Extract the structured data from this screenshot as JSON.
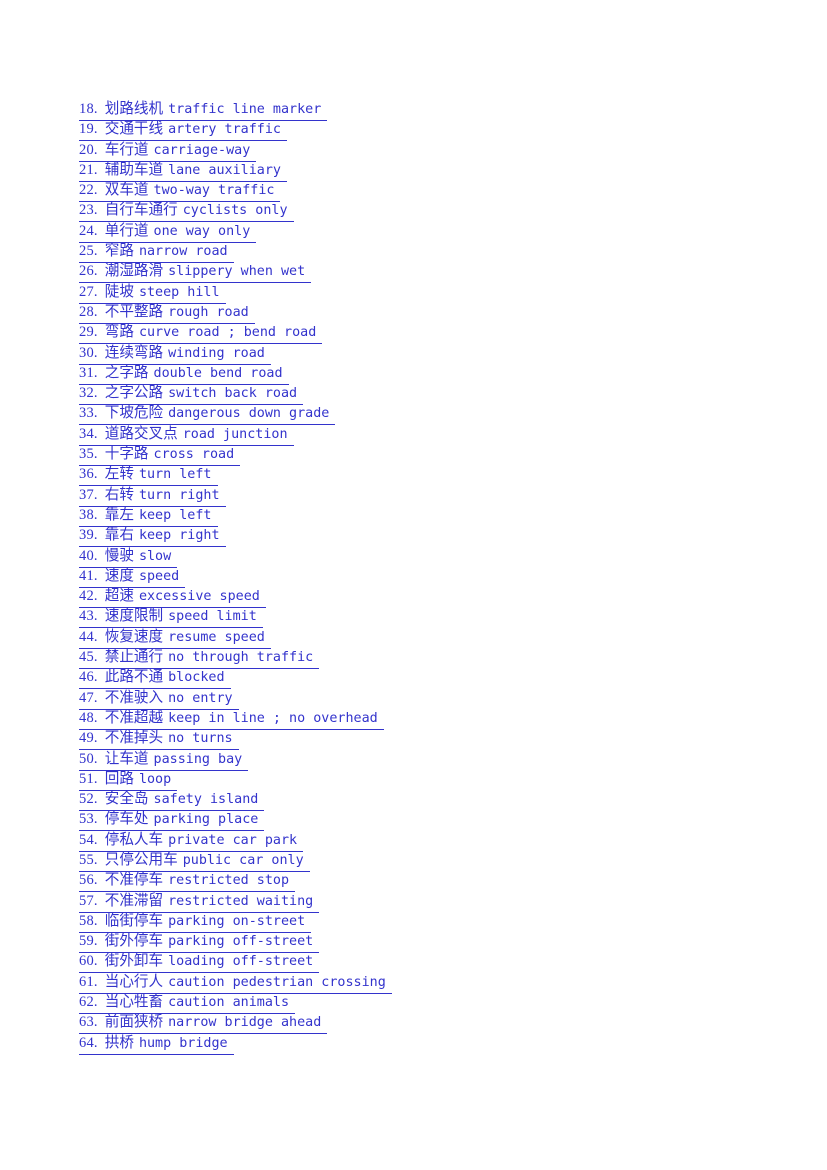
{
  "document": {
    "type": "glossary-page",
    "topic": "Road and traffic terminology (Chinese-English)",
    "link_color": "#3333CC",
    "background_color": "#FFFFFF",
    "entries": [
      {
        "number": "18.",
        "chinese": "划路线机",
        "english": "traffic line marker"
      },
      {
        "number": "19.",
        "chinese": "交通干线",
        "english": "artery traffic"
      },
      {
        "number": "20.",
        "chinese": "车行道",
        "english": "carriage-way"
      },
      {
        "number": "21.",
        "chinese": "辅助车道",
        "english": "lane auxiliary"
      },
      {
        "number": "22.",
        "chinese": "双车道",
        "english": "two-way traffic"
      },
      {
        "number": "23.",
        "chinese": "自行车通行",
        "english": "cyclists only"
      },
      {
        "number": "24.",
        "chinese": "单行道",
        "english": "one way only"
      },
      {
        "number": "25.",
        "chinese": "窄路",
        "english": "narrow road"
      },
      {
        "number": "26.",
        "chinese": "潮湿路滑",
        "english": "slippery when wet"
      },
      {
        "number": "27.",
        "chinese": "陡坡",
        "english": "steep hill"
      },
      {
        "number": "28.",
        "chinese": "不平整路",
        "english": "rough road"
      },
      {
        "number": "29.",
        "chinese": "弯路",
        "english": "curve road ; bend road"
      },
      {
        "number": "30.",
        "chinese": "连续弯路",
        "english": "winding road"
      },
      {
        "number": "31.",
        "chinese": "之字路",
        "english": "double bend road"
      },
      {
        "number": "32.",
        "chinese": "之字公路",
        "english": "switch back road"
      },
      {
        "number": "33.",
        "chinese": "下坡危险",
        "english": "dangerous down grade"
      },
      {
        "number": "34.",
        "chinese": "道路交叉点",
        "english": "road junction"
      },
      {
        "number": "35.",
        "chinese": "十字路",
        "english": "cross road"
      },
      {
        "number": "36.",
        "chinese": "左转",
        "english": "turn left"
      },
      {
        "number": "37.",
        "chinese": "右转",
        "english": "turn right"
      },
      {
        "number": "38.",
        "chinese": "靠左",
        "english": "keep left"
      },
      {
        "number": "39.",
        "chinese": "靠右",
        "english": "keep right"
      },
      {
        "number": "40.",
        "chinese": "慢驶",
        "english": "slow"
      },
      {
        "number": "41.",
        "chinese": "速度",
        "english": "speed"
      },
      {
        "number": "42.",
        "chinese": "超速",
        "english": "excessive speed"
      },
      {
        "number": "43.",
        "chinese": "速度限制",
        "english": "speed limit"
      },
      {
        "number": "44.",
        "chinese": "恢复速度",
        "english": "resume speed"
      },
      {
        "number": "45.",
        "chinese": "禁止通行",
        "english": "no through traffic"
      },
      {
        "number": "46.",
        "chinese": "此路不通",
        "english": "blocked"
      },
      {
        "number": "47.",
        "chinese": "不准驶入",
        "english": "no entry"
      },
      {
        "number": "48.",
        "chinese": "不准超越",
        "english": "keep in line ; no overhead"
      },
      {
        "number": "49.",
        "chinese": "不准掉头",
        "english": "no turns"
      },
      {
        "number": "50.",
        "chinese": "让车道",
        "english": "passing bay"
      },
      {
        "number": "51.",
        "chinese": "回路",
        "english": "loop"
      },
      {
        "number": "52.",
        "chinese": "安全岛",
        "english": "safety island"
      },
      {
        "number": "53.",
        "chinese": "停车处",
        "english": "parking place"
      },
      {
        "number": "54.",
        "chinese": "停私人车",
        "english": "private car park"
      },
      {
        "number": "55.",
        "chinese": "只停公用车",
        "english": "public car only"
      },
      {
        "number": "56.",
        "chinese": "不准停车",
        "english": "restricted stop"
      },
      {
        "number": "57.",
        "chinese": "不准滞留",
        "english": "restricted waiting"
      },
      {
        "number": "58.",
        "chinese": "临街停车",
        "english": "parking on-street"
      },
      {
        "number": "59.",
        "chinese": "街外停车",
        "english": "parking off-street"
      },
      {
        "number": "60.",
        "chinese": "街外卸车",
        "english": "loading off-street"
      },
      {
        "number": "61.",
        "chinese": "当心行人",
        "english": "caution pedestrian crossing"
      },
      {
        "number": "62.",
        "chinese": "当心牲畜",
        "english": "caution animals"
      },
      {
        "number": "63.",
        "chinese": "前面狭桥",
        "english": "narrow bridge ahead"
      },
      {
        "number": "64.",
        "chinese": "拱桥",
        "english": "hump bridge"
      }
    ]
  }
}
